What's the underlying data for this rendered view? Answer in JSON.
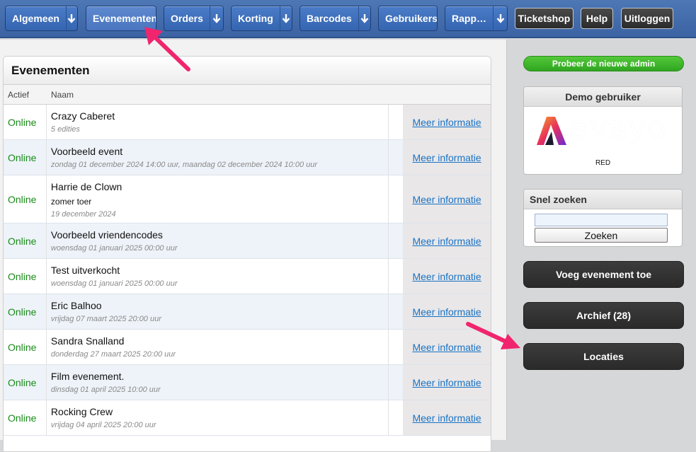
{
  "nav": {
    "items": [
      {
        "label": "Algemeen",
        "dropdown": true
      },
      {
        "label": "Evenementen",
        "dropdown": false
      },
      {
        "label": "Orders",
        "dropdown": true
      },
      {
        "label": "Korting",
        "dropdown": true
      },
      {
        "label": "Barcodes",
        "dropdown": true
      },
      {
        "label": "Gebruikers",
        "dropdown": false
      },
      {
        "label": "Rapp…",
        "dropdown": true
      }
    ],
    "active": "Evenementen",
    "ticketshop": "Ticketshop",
    "help": "Help",
    "logout": "Uitloggen"
  },
  "events_panel": {
    "title": "Evenementen",
    "columns": [
      "Actief",
      "Naam"
    ],
    "more_label": "Meer informatie",
    "rows": [
      {
        "status": "Online",
        "name": "Crazy Caberet",
        "subtitle": "",
        "detail": "5 edities"
      },
      {
        "status": "Online",
        "name": "Voorbeeld event",
        "subtitle": "",
        "detail": "zondag 01 december 2024 14:00 uur, maandag 02 december 2024 10:00 uur"
      },
      {
        "status": "Online",
        "name": "Harrie de Clown",
        "subtitle": "zomer toer",
        "detail": "19 december 2024"
      },
      {
        "status": "Online",
        "name": "Voorbeeld vriendencodes",
        "subtitle": "",
        "detail": "woensdag 01 januari 2025 00:00 uur"
      },
      {
        "status": "Online",
        "name": "Test uitverkocht",
        "subtitle": "",
        "detail": "woensdag 01 januari 2025 00:00 uur"
      },
      {
        "status": "Online",
        "name": "Eric Balhoo",
        "subtitle": "",
        "detail": "vrijdag 07 maart 2025 20:00 uur"
      },
      {
        "status": "Online",
        "name": "Sandra Snalland",
        "subtitle": "",
        "detail": "donderdag 27 maart 2025 20:00 uur"
      },
      {
        "status": "Online",
        "name": "Film evenement.",
        "subtitle": "",
        "detail": "dinsdag 01 april 2025 10:00 uur"
      },
      {
        "status": "Online",
        "name": "Rocking Crew",
        "subtitle": "",
        "detail": "vrijdag 04 april 2025 20:00 uur"
      }
    ]
  },
  "sidebar": {
    "try_new_admin": "Probeer de nieuwe admin",
    "demo_title": "Demo gebruiker",
    "logo_text": "avayo",
    "logo_caption": "RED",
    "quick_search_title": "Snel zoeken",
    "search_value": "",
    "search_button": "Zoeken",
    "add_event": "Voeg evenement toe",
    "archive": "Archief (28)",
    "locations": "Locaties"
  },
  "colors": {
    "nav_blue": "#3f6aae",
    "online_green": "#1a8a1a",
    "link_blue": "#1a73c4",
    "arrow_pink": "#f0256e",
    "try_green": "#3cb52a"
  }
}
